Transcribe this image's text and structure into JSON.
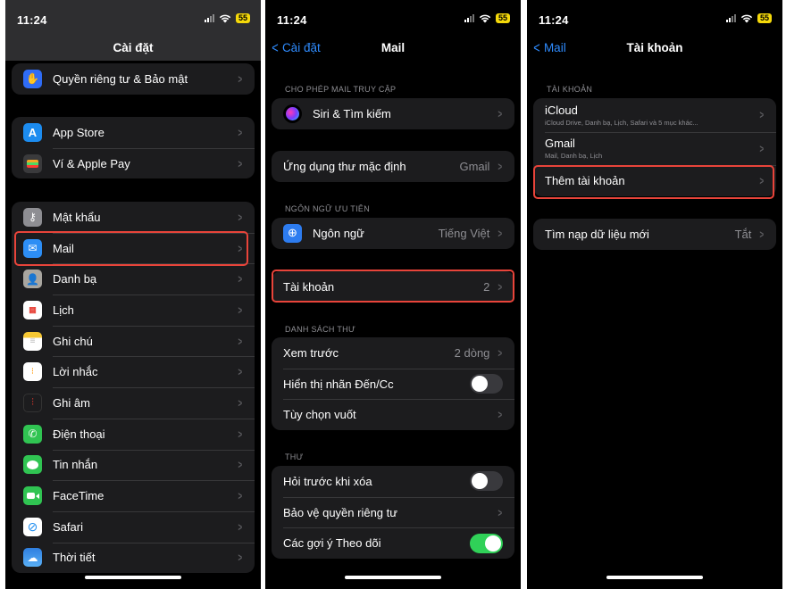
{
  "status": {
    "time": "11:24",
    "battery": "55"
  },
  "screen1": {
    "title": "Cài đặt",
    "group1": [
      {
        "label": "Quyền riêng tư & Bảo mật",
        "icon": "hand-icon",
        "color": "#2f6cf6"
      }
    ],
    "group2": [
      {
        "label": "App Store",
        "icon": "app-store-icon",
        "color": "#1c8cf0"
      },
      {
        "label": "Ví & Apple Pay",
        "icon": "wallet-icon",
        "color": "#2a2a2c"
      }
    ],
    "group3": [
      {
        "label": "Mật khẩu",
        "icon": "key-icon",
        "color": "#8e8e93"
      },
      {
        "label": "Mail",
        "icon": "mail-icon",
        "color": "#2d8ef5"
      },
      {
        "label": "Danh bạ",
        "icon": "contacts-icon",
        "color": "#a9a6a0"
      },
      {
        "label": "Lịch",
        "icon": "calendar-icon",
        "color": "#ffffff"
      },
      {
        "label": "Ghi chú",
        "icon": "notes-icon",
        "color": "#f7c833"
      },
      {
        "label": "Lời nhắc",
        "icon": "reminders-icon",
        "color": "#ffffff"
      },
      {
        "label": "Ghi âm",
        "icon": "voice-memos-icon",
        "color": "#1c1c1e"
      },
      {
        "label": "Điện thoại",
        "icon": "phone-icon",
        "color": "#30c452"
      },
      {
        "label": "Tin nhắn",
        "icon": "messages-icon",
        "color": "#30c452"
      },
      {
        "label": "FaceTime",
        "icon": "facetime-icon",
        "color": "#30c452"
      },
      {
        "label": "Safari",
        "icon": "safari-icon",
        "color": "#1c8cf0"
      },
      {
        "label": "Thời tiết",
        "icon": "weather-icon",
        "color": "#3a8ff0"
      }
    ]
  },
  "screen2": {
    "back": "Cài đặt",
    "title": "Mail",
    "header_access": "CHO PHÉP MAIL TRUY CẬP",
    "siri": "Siri & Tìm kiếm",
    "default_app": {
      "label": "Ứng dụng thư mặc định",
      "value": "Gmail"
    },
    "header_language": "NGÔN NGỮ ƯU TIÊN",
    "language": {
      "label": "Ngôn ngữ",
      "value": "Tiếng Việt"
    },
    "accounts": {
      "label": "Tài khoản",
      "value": "2"
    },
    "header_list": "DANH SÁCH THƯ",
    "preview": {
      "label": "Xem trước",
      "value": "2 dòng"
    },
    "show_to_cc": {
      "label": "Hiển thị nhãn Đến/Cc",
      "on": false
    },
    "swipe": "Tùy chọn vuốt",
    "header_mail": "THƯ",
    "ask_delete": {
      "label": "Hỏi trước khi xóa",
      "on": false
    },
    "privacy": "Bảo vệ quyền riêng tư",
    "follow_up": {
      "label": "Các gợi ý Theo dõi",
      "on": true
    }
  },
  "screen3": {
    "back": "Mail",
    "title": "Tài khoản",
    "header": "TÀI KHOẢN",
    "icloud": {
      "label": "iCloud",
      "sub": "iCloud Drive, Danh bạ, Lịch, Safari và 5 mục khác..."
    },
    "gmail": {
      "label": "Gmail",
      "sub": "Mail, Danh bạ, Lịch"
    },
    "add": "Thêm tài khoản",
    "fetch": {
      "label": "Tìm nạp dữ liệu mới",
      "value": "Tắt"
    }
  }
}
